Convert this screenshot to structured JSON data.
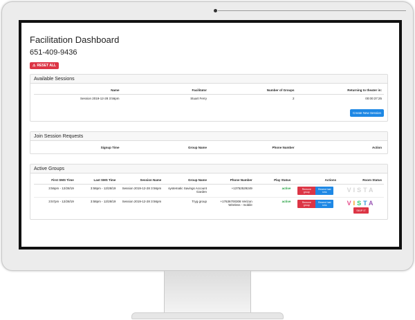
{
  "dashboard": {
    "title": "Facilitation Dashboard",
    "phone": "651-409-9436",
    "reset_label": "RESET ALL"
  },
  "available_sessions": {
    "header": "Available Sessions",
    "columns": [
      "Name",
      "Facilitator",
      "Number of Groups",
      "Returning to theater in:"
    ],
    "rows": [
      [
        "Session 2019-12-28 3:56pm",
        "Stuart Ferry",
        "2",
        "00:00:37:25"
      ]
    ],
    "create_label": "Create New Session"
  },
  "join_requests": {
    "header": "Join Session Requests",
    "columns": [
      "Signup Time",
      "Group Name",
      "Phone Number",
      "Action"
    ]
  },
  "active_groups": {
    "header": "Active Groups",
    "columns": [
      "First SMS Time",
      "Last SMS Time",
      "Session Name",
      "Group Name",
      "Phone Number",
      "Play Status",
      "Actions",
      "Room Status"
    ],
    "rows": [
      {
        "first": "3:56pm - 12/28/19",
        "last": "3:58pm - 12/28/19",
        "session": "Session 2019-12-28 3:56pm",
        "group": "systematic Savings Account Garden",
        "phone": "+13752529249",
        "status": "active",
        "remove": "Remove group",
        "resend": "Resend last sms",
        "room": "VISTA"
      },
      {
        "first": "3:57pm - 12/28/19",
        "last": "3:58pm - 12/28/19",
        "session": "Session 2019-12-28 3:56pm",
        "group": "Tryg group",
        "phone": "+17636700308 Verizon Wireless - mobile",
        "status": "active",
        "remove": "Remove group",
        "resend": "Resend last sms",
        "room": "VISTA",
        "skip": "SKIP IT"
      }
    ]
  },
  "colors": {
    "danger": "#dc3545",
    "primary": "#1e88e5",
    "success": "#1e9e3c"
  }
}
